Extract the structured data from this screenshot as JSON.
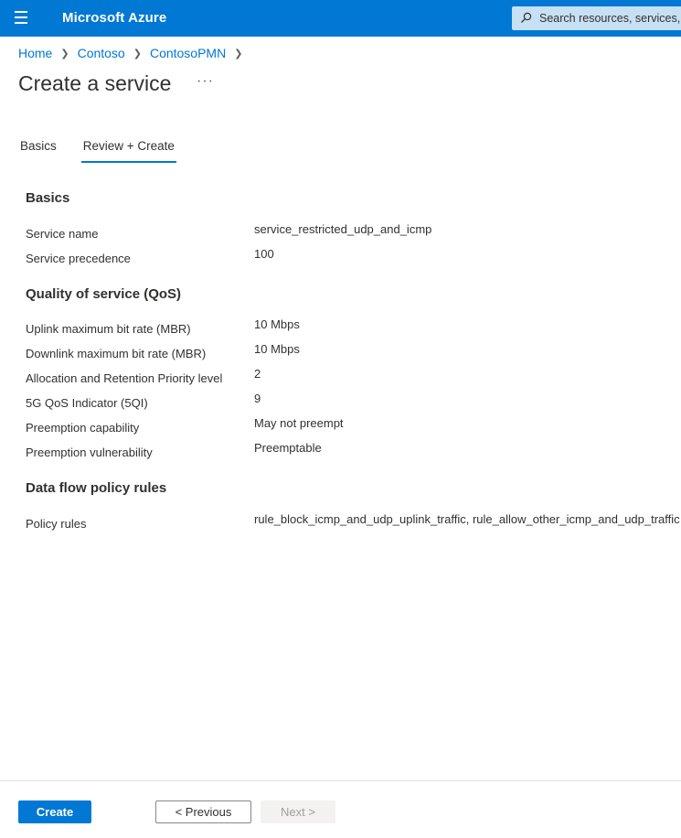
{
  "header": {
    "menu_icon": "hamburger-icon",
    "title": "Microsoft Azure",
    "search_icon": "search-icon",
    "search_placeholder": "Search resources, services, and docs (G+/)"
  },
  "breadcrumb": {
    "items": [
      "Home",
      "Contoso",
      "ContosoPMN"
    ],
    "separator_icon": "chevron-right-icon"
  },
  "page": {
    "title": "Create a service",
    "more_label": "···"
  },
  "tabs": [
    {
      "label": "Basics",
      "active": false
    },
    {
      "label": "Review + Create",
      "active": true
    }
  ],
  "review": {
    "basics": {
      "heading": "Basics",
      "rows": [
        {
          "label": "Service name",
          "value": "service_restricted_udp_and_icmp"
        },
        {
          "label": "Service precedence",
          "value": "100"
        }
      ]
    },
    "qos": {
      "heading": "Quality of service (QoS)",
      "rows": [
        {
          "label": "Uplink maximum bit rate (MBR)",
          "value": "10 Mbps"
        },
        {
          "label": "Downlink maximum bit rate (MBR)",
          "value": "10 Mbps"
        },
        {
          "label": "Allocation and Retention Priority level",
          "value": "2"
        },
        {
          "label": "5G QoS Indicator (5QI)",
          "value": "9"
        },
        {
          "label": "Preemption capability",
          "value": "May not preempt"
        },
        {
          "label": "Preemption vulnerability",
          "value": "Preemptable"
        }
      ]
    },
    "dataflow": {
      "heading": "Data flow policy rules",
      "rows": [
        {
          "label": "Policy rules",
          "value": "rule_block_icmp_and_udp_uplink_traffic, rule_allow_other_icmp_and_udp_traffic"
        }
      ]
    }
  },
  "footer": {
    "create_label": "Create",
    "previous_label": "< Previous",
    "next_label": "Next >",
    "next_disabled": true
  },
  "colors": {
    "brand": "#0078d4",
    "search_bg": "#c7e0f4",
    "text": "#323130",
    "disabled_bg": "#f3f2f1"
  }
}
